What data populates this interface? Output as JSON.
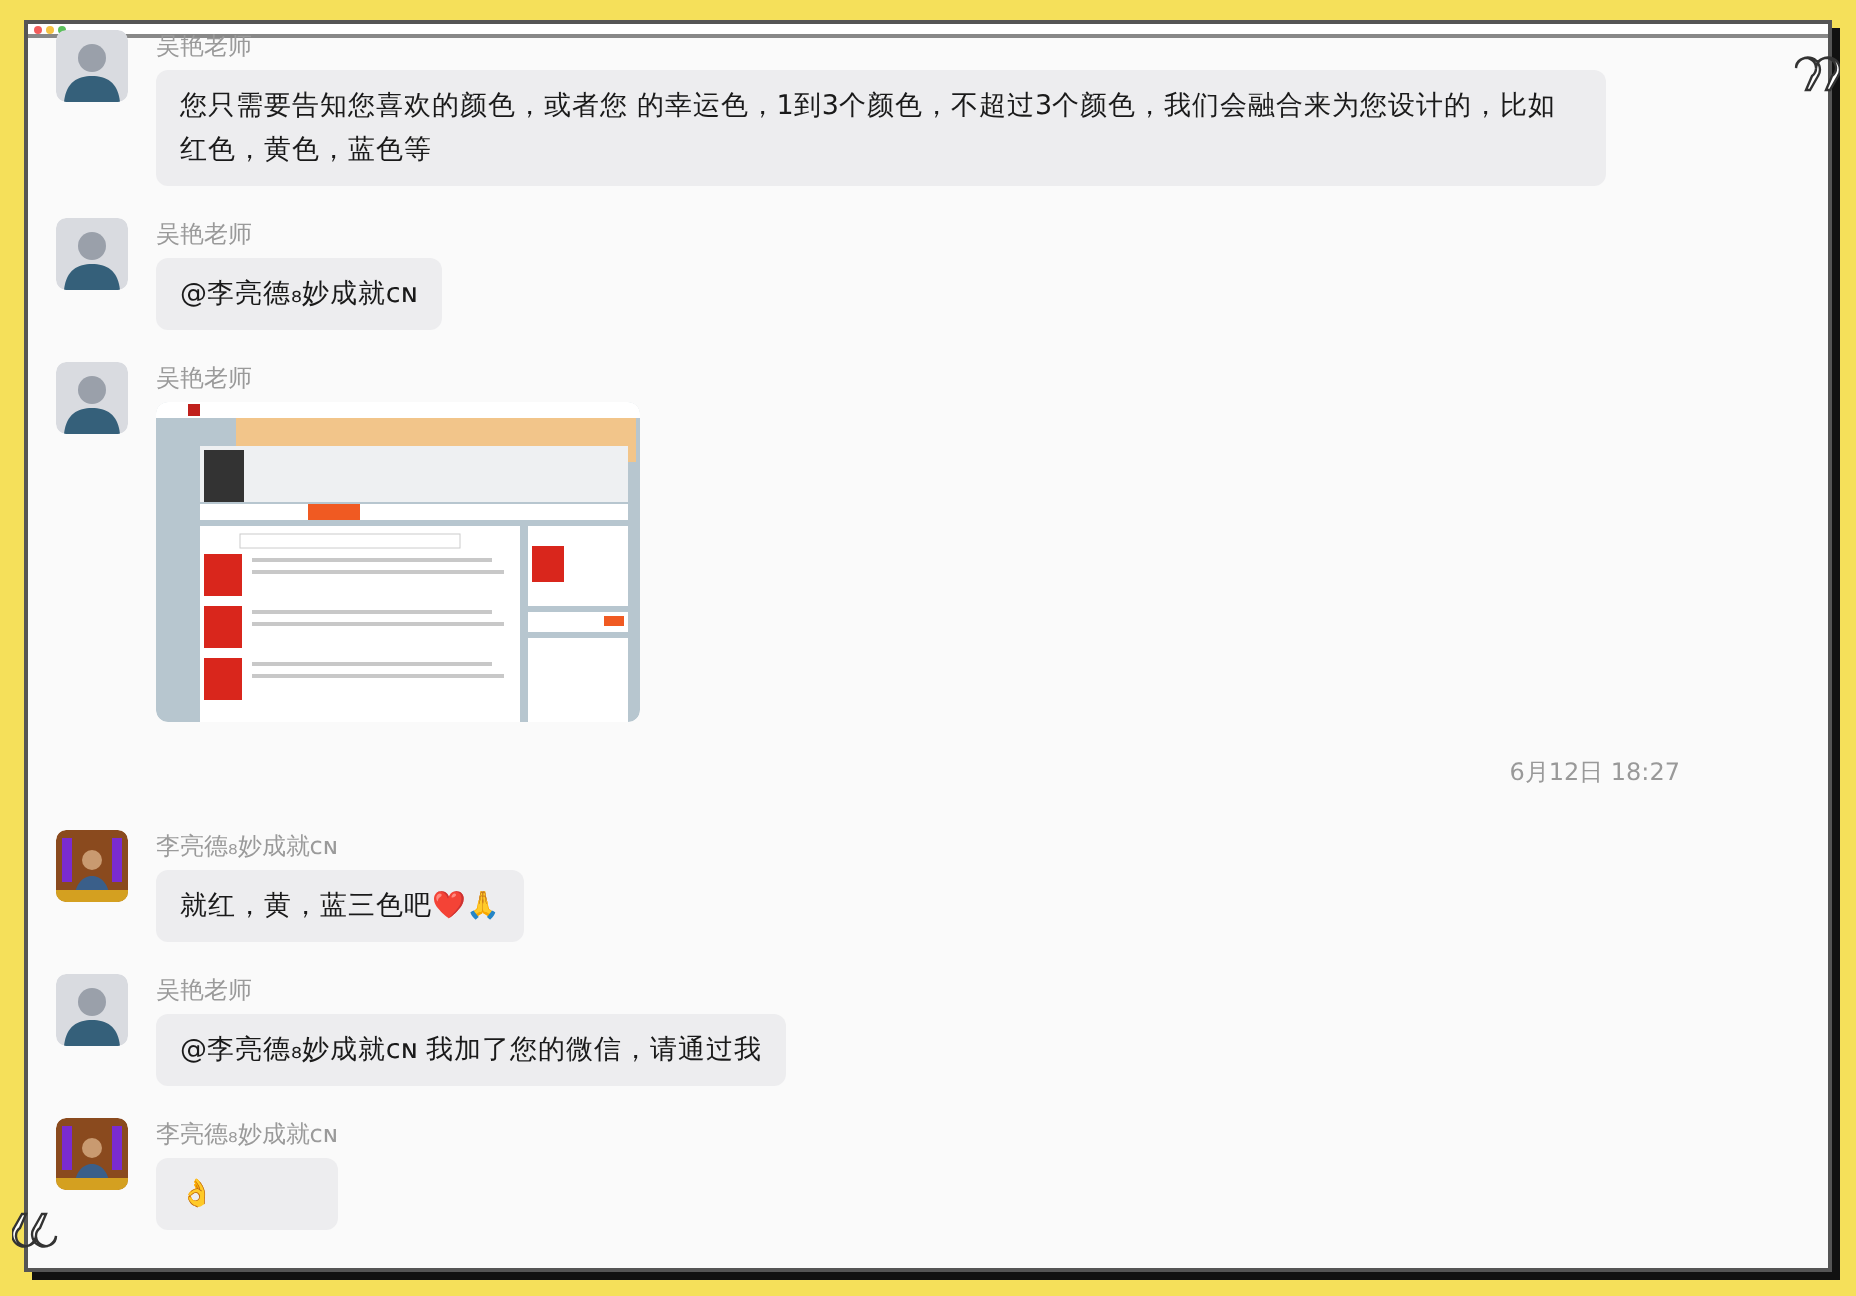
{
  "messages": [
    {
      "kind": "text",
      "sender": "吴艳老师",
      "avatar": {
        "kind": "portrait"
      },
      "text": "您只需要告知您喜欢的颜色，或者您 的幸运色，1到3个颜色，不超过3个颜色，我们会融合来为您设计的，比如红色，黄色，蓝色等"
    },
    {
      "kind": "text",
      "sender": "吴艳老师",
      "avatar": {
        "kind": "portrait"
      },
      "text": "@李亮德₈妙成就ᴄɴ"
    },
    {
      "kind": "image",
      "sender": "吴艳老师",
      "avatar": {
        "kind": "portrait"
      }
    },
    {
      "kind": "time",
      "text": "6月12日 18:27"
    },
    {
      "kind": "text",
      "sender": "李亮德₈妙成就ᴄɴ",
      "avatar": {
        "kind": "poster"
      },
      "text": "就红，黄，蓝三色吧❤️🙏"
    },
    {
      "kind": "text",
      "sender": "吴艳老师",
      "avatar": {
        "kind": "portrait"
      },
      "text": "@李亮德₈妙成就ᴄɴ 我加了您的微信，请通过我"
    },
    {
      "kind": "text",
      "sender": "李亮德₈妙成就ᴄɴ",
      "avatar": {
        "kind": "poster"
      },
      "text": "👌"
    }
  ]
}
